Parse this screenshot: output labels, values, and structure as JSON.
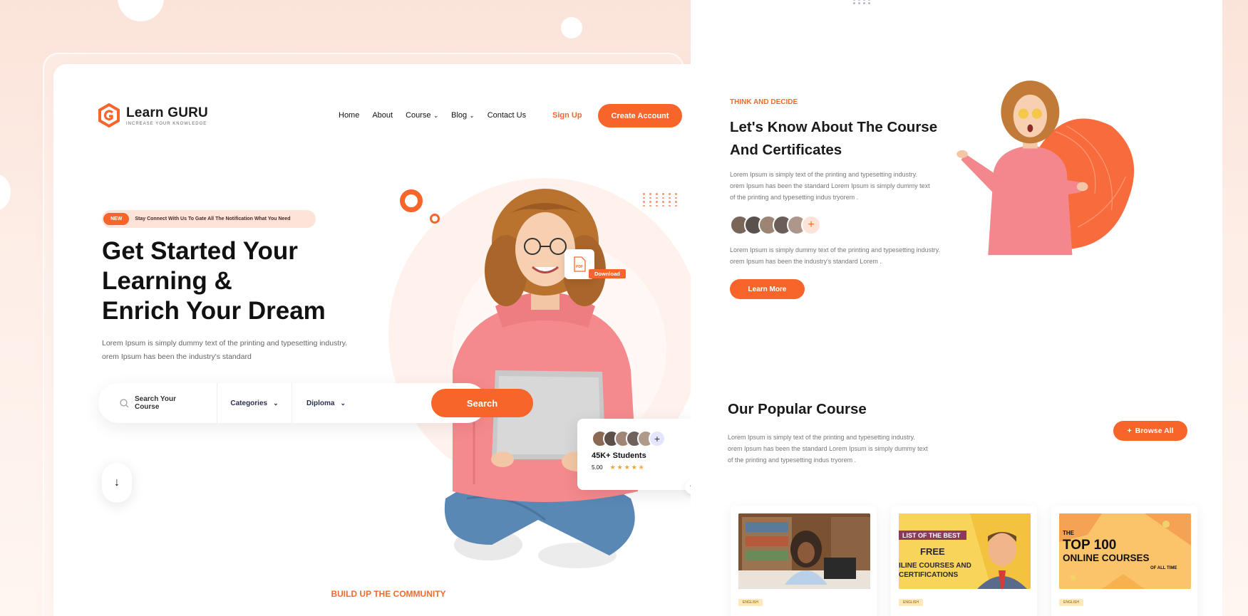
{
  "left": {
    "logo": {
      "name": "Learn GURU",
      "tagline": "INCREASE YOUR KNOWLEDGE"
    },
    "nav": [
      {
        "label": "Home",
        "dropdown": false
      },
      {
        "label": "About",
        "dropdown": false
      },
      {
        "label": "Course",
        "dropdown": true
      },
      {
        "label": "Blog",
        "dropdown": true
      },
      {
        "label": "Contact Us",
        "dropdown": false
      }
    ],
    "signup_label": "Sign Up",
    "create_account_label": "Create Account",
    "pill": {
      "badge": "NEW",
      "text": "Stay Connect With Us To Gate All The Notification What You Need"
    },
    "hero_title": [
      "Get Started Your",
      "Learning &",
      "Enrich Your Dream"
    ],
    "hero_desc": [
      "Lorem Ipsum is simply dummy text of the printing and typesetting industry.",
      "orem Ipsum has been the industry's standard"
    ],
    "search": {
      "placeholder": "Search Your Course",
      "categories_label": "Categories",
      "diploma_label": "Diploma",
      "button_label": "Search"
    },
    "pdf_label": "PDF",
    "download_label": "Download",
    "students_card": {
      "title": "45K+ Students",
      "rating": "5.00",
      "stars": "★★★★✬"
    },
    "community_eyebrow": "BUILD UP THE COMMUNITY"
  },
  "right": {
    "eyebrow": "THINK AND DECIDE",
    "title": [
      "Let's Know About The Course",
      "And Certificates"
    ],
    "desc1": [
      "Lorem Ipsum is simply text of the printing and typesetting industry.",
      "orem Ipsum has been the standard Lorem Ipsum is simply dummy text",
      "of the printing and typesetting indus tryorem ."
    ],
    "desc2": [
      "Lorem Ipsum is simply dummy text of the printing and typesetting industry.",
      "orem Ipsum has been the industry's standard Lorem ."
    ],
    "learn_more_label": "Learn More",
    "popular_title": "Our Popular Course",
    "popular_desc": [
      "Lorem Ipsum is simply text of the printing and typesetting industry.",
      "orem Ipsum has been the standard Lorem Ipsum is simply dummy text",
      "of the printing and typesetting indus tryorem ."
    ],
    "browse_label": "Browse All",
    "courses": [
      {
        "tag": "ENGLISH"
      },
      {
        "tag": "ENGLISH",
        "banner_top": "LIST OF THE BEST",
        "banner_free": "FREE",
        "banner_lines": [
          "ILINE COURSES AND",
          "CERTIFICATIONS"
        ]
      },
      {
        "tag": "ENGLISH",
        "banner_the": "THE",
        "banner_big": "TOP 100",
        "banner_mid": "ONLINE COURSES",
        "banner_small": "OF ALL TIME"
      }
    ]
  },
  "colors": {
    "accent": "#f8652a",
    "peach_bg": "#fbe3d9",
    "text_dark": "#111111"
  }
}
